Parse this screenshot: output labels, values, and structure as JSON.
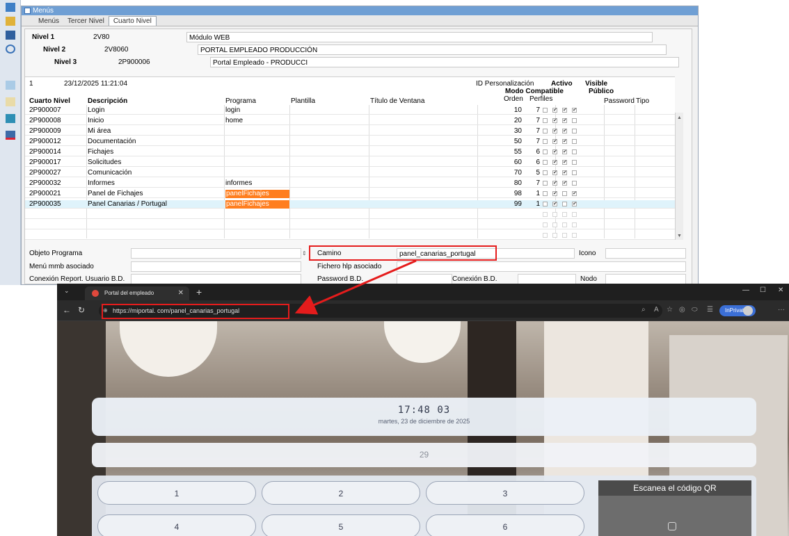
{
  "app": {
    "window_title": "Menús",
    "tabs": [
      "Menús",
      "Tercer Nivel",
      "Cuarto Nivel"
    ],
    "levels": {
      "nivel1": {
        "label": "Nivel 1",
        "code": "2V80",
        "desc": "Módulo WEB"
      },
      "nivel2": {
        "label": "Nivel 2",
        "code": "2V8060",
        "desc": "PORTAL EMPLEADO PRODUCCIÓN"
      },
      "nivel3": {
        "label": "Nivel 3",
        "code": "2P900006",
        "desc": "Portal Empleado      - PRODUCCI"
      }
    },
    "record": {
      "index": "1",
      "timestamp": "23/12/2025 11:21:04"
    },
    "headers": {
      "cuarto_nivel": "Cuarto Nivel",
      "descripcion": "Descripción",
      "programa": "Programa",
      "plantilla": "Plantilla",
      "titulo": "Título de Ventana",
      "id_personalizacion": "ID Personalización",
      "activo": "Activo",
      "visible": "Visible",
      "modo_compatible": "Modo Compatible",
      "publico": "Público",
      "orden": "Orden",
      "perfiles": "Perfiles",
      "password": "Password",
      "tipo": "Tipo"
    },
    "rows": [
      {
        "code": "2P900007",
        "desc": "Login",
        "programa": "login",
        "orden": "10",
        "perfiles": "7",
        "checks": [
          "",
          "✔",
          "✔",
          "✔"
        ]
      },
      {
        "code": "2P900008",
        "desc": "Inicio",
        "programa": "home",
        "orden": "20",
        "perfiles": "7",
        "checks": [
          "",
          "✔",
          "✔",
          ""
        ]
      },
      {
        "code": "2P900009",
        "desc": "Mi área",
        "programa": "",
        "orden": "30",
        "perfiles": "7",
        "checks": [
          "",
          "✔",
          "✔",
          ""
        ]
      },
      {
        "code": "2P900012",
        "desc": "Documentación",
        "programa": "",
        "orden": "50",
        "perfiles": "7",
        "checks": [
          "",
          "✔",
          "✔",
          ""
        ]
      },
      {
        "code": "2P900014",
        "desc": "Fichajes",
        "programa": "",
        "orden": "55",
        "perfiles": "6",
        "checks": [
          "",
          "✔",
          "✔",
          ""
        ]
      },
      {
        "code": "2P900017",
        "desc": "Solicitudes",
        "programa": "",
        "orden": "60",
        "perfiles": "6",
        "checks": [
          "",
          "✔",
          "✔",
          ""
        ]
      },
      {
        "code": "2P900027",
        "desc": "Comunicación",
        "programa": "",
        "orden": "70",
        "perfiles": "5",
        "checks": [
          "",
          "✔",
          "✔",
          ""
        ]
      },
      {
        "code": "2P900032",
        "desc": "Informes",
        "programa": "informes",
        "orden": "80",
        "perfiles": "7",
        "checks": [
          "",
          "✔",
          "✔",
          ""
        ]
      },
      {
        "code": "2P900021",
        "desc": "Panel de Fichajes",
        "programa": "panelFichajes",
        "orden": "98",
        "perfiles": "1",
        "checks": [
          "",
          "✔",
          "",
          "✔"
        ]
      },
      {
        "code": "2P900035",
        "desc": "Panel Canarias / Portugal",
        "programa": "panelFichajes",
        "orden": "99",
        "perfiles": "1",
        "checks": [
          "",
          "✔",
          "",
          "✔"
        ]
      }
    ],
    "bottom": {
      "objeto_programa": "Objeto Programa",
      "camino_label": "Camino",
      "camino_value": "panel_canarias_portugal",
      "icono": "Icono",
      "menu_mmb": "Menú mmb asociado",
      "fichero_hlp": "Fichero hlp asociado",
      "conexion_report": "Conexión Report. Usuario B.D.",
      "password_bd": "Password B.D.",
      "conexion_bd": "Conexión B.D.",
      "nodo": "Nodo"
    }
  },
  "browser": {
    "tab_title": "Portal del empleado",
    "url": "https://miportal.                    com/panel_canarias_portugal",
    "inprivate": "InPrivate",
    "clock": "17:48 03",
    "date": "martes, 23 de diciembre de 2025",
    "number_display": "29",
    "keys": [
      "1",
      "2",
      "3",
      "4",
      "5",
      "6"
    ],
    "qr_title": "Escanea el código QR"
  },
  "colors": {
    "highlight": "#e51c1c",
    "programa_highlight": "#ff7e1f",
    "selected_row": "#dff3fb",
    "inprivate": "#3b6fd6"
  }
}
